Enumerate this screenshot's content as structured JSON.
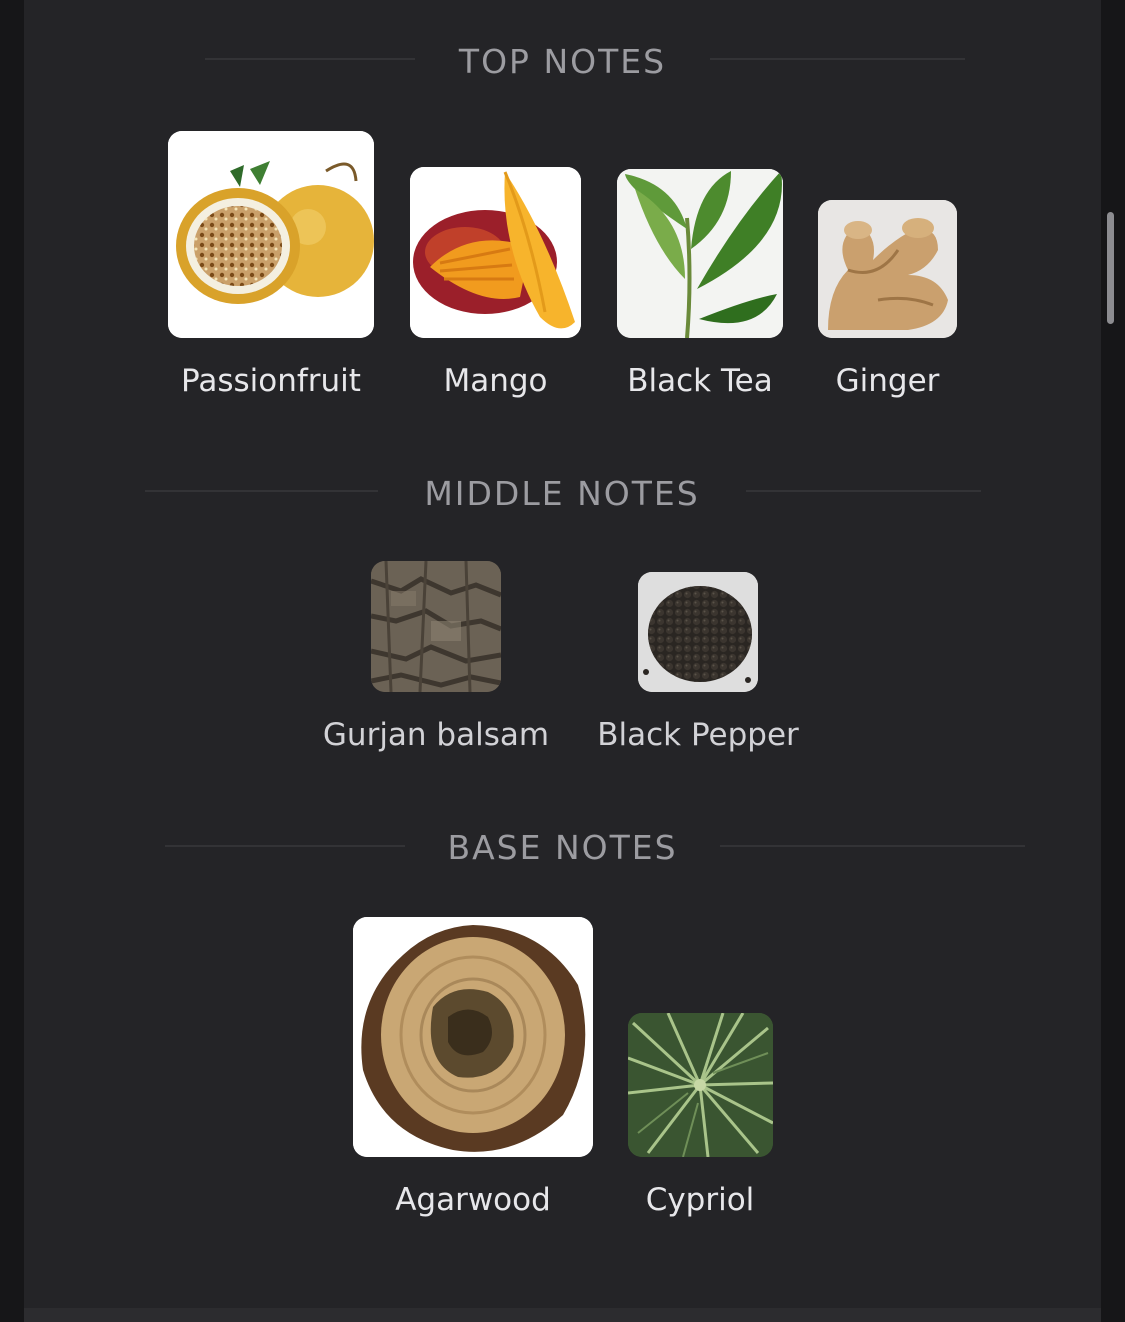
{
  "top": {
    "title": "TOP NOTES",
    "items": [
      {
        "label": "Passionfruit",
        "icon": "passionfruit-icon"
      },
      {
        "label": "Mango",
        "icon": "mango-icon"
      },
      {
        "label": "Black Tea",
        "icon": "black-tea-icon"
      },
      {
        "label": "Ginger",
        "icon": "ginger-icon"
      }
    ]
  },
  "middle": {
    "title": "MIDDLE NOTES",
    "items": [
      {
        "label": "Gurjan balsam",
        "icon": "gurjan-balsam-icon"
      },
      {
        "label": "Black Pepper",
        "icon": "black-pepper-icon"
      }
    ]
  },
  "base": {
    "title": "BASE NOTES",
    "items": [
      {
        "label": "Agarwood",
        "icon": "agarwood-icon"
      },
      {
        "label": "Cypriol",
        "icon": "cypriol-icon"
      }
    ]
  },
  "colors": {
    "background": "#242427",
    "header_text": "#9c9ca1",
    "label_text": "#e7e7ea"
  }
}
